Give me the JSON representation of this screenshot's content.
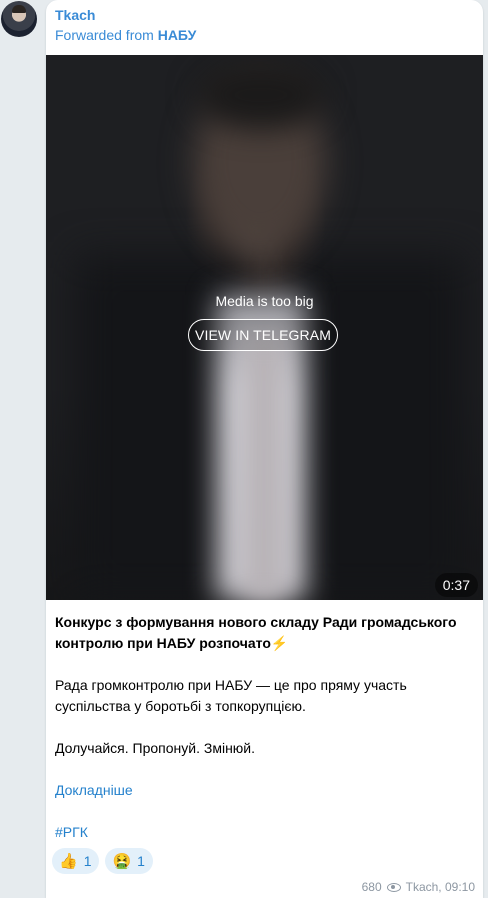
{
  "post": {
    "author": "Tkach",
    "forwarded_prefix": "Forwarded from",
    "forwarded_source": "НАБУ",
    "media": {
      "notice": "Media is too big",
      "button_label": "VIEW IN TELEGRAM",
      "duration": "0:37"
    },
    "text": {
      "headline": "Конкурс з формування нового складу Ради громадського контролю при НАБУ розпочато",
      "headline_emoji": "⚡",
      "paragraph1": "Рада громконтролю при НАБУ — це про пряму участь суспільства у боротьбі з топкорупцією.",
      "paragraph2": "Долучайся. Пропонуй. Змінюй.",
      "link": "Докладніше",
      "hashtag": "#РГК"
    },
    "reactions": [
      {
        "emoji": "👍",
        "icon": "thumbs-up-icon",
        "count": "1"
      },
      {
        "emoji": "🤮",
        "icon": "vomiting-face-icon",
        "count": "1"
      }
    ],
    "views": "680",
    "signature": "Tkach, 09:10"
  },
  "colors": {
    "accent": "#3a8bd6",
    "link": "#2481cc",
    "background": "#e6ebee",
    "meta": "#8d97a2"
  }
}
